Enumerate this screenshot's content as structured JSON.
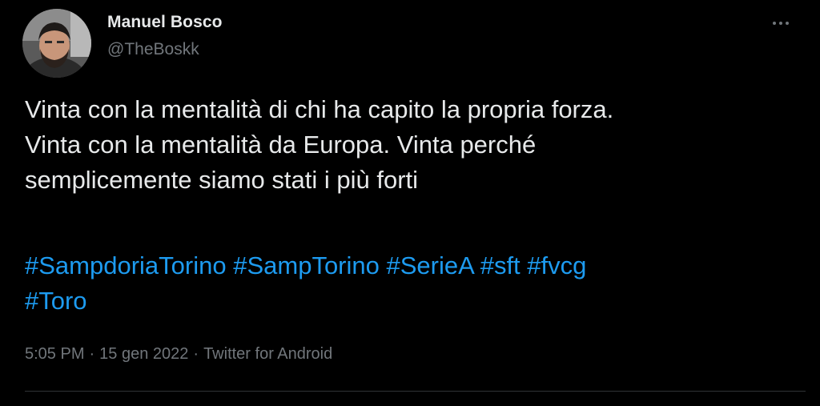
{
  "author": {
    "name": "Manuel Bosco",
    "handle": "@TheBoskk"
  },
  "tweet": {
    "text_lines": [
      "Vinta con la mentalità di chi ha capito la propria forza.",
      "Vinta con la mentalità da Europa. Vinta perché",
      "semplicemente siamo stati i più forti"
    ],
    "hashtags": [
      "#SampdoriaTorino",
      "#SampTorino",
      "#SerieA",
      "#sft",
      "#fvcg",
      "#Toro"
    ]
  },
  "meta": {
    "time": "5:05 PM",
    "separator": "·",
    "date": "15 gen 2022",
    "source": "Twitter for Android"
  },
  "colors": {
    "background": "#000000",
    "text": "#e7e9ea",
    "secondary": "#71767b",
    "hashtag": "#1d9bf0",
    "divider": "#2f3336"
  },
  "icons": {
    "more": "more-horizontal-icon"
  }
}
